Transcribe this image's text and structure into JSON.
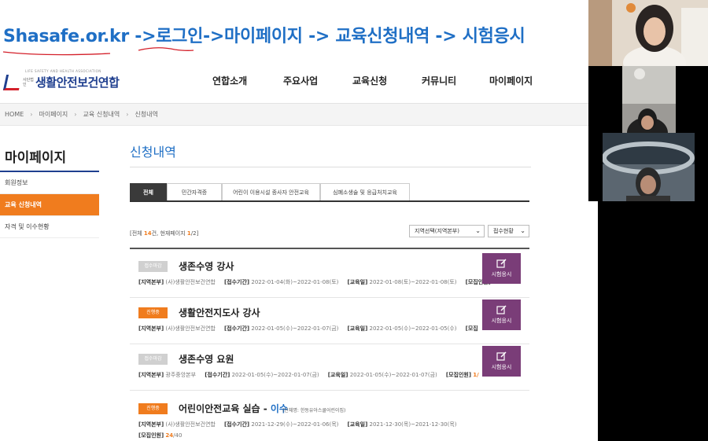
{
  "annotation": {
    "text": "Shasafe.or.kr ->로그인->마이페이지 -> 교육신청내역 -> 시험응시",
    "color": "#1f6fc5",
    "pen_color": "#d4202a"
  },
  "site": {
    "logo": {
      "tagline": "LIFE SAFETY AND HEALTH ASSOCIATION",
      "sub": "사단법인",
      "name": "생활안전보건연합"
    },
    "nav": [
      "연합소개",
      "주요사업",
      "교육신청",
      "커뮤니티",
      "마이페이지"
    ],
    "breadcrumb": [
      "HOME",
      "마이페이지",
      "교육 신청내역",
      "신청내역"
    ],
    "sidebar": {
      "title": "마이페이지",
      "items": [
        "회원정보",
        "교육 신청내역",
        "자격 및 이수현황"
      ],
      "active_index": 1
    },
    "content": {
      "title": "신청내역",
      "tabs": [
        "전체",
        "민간자격증",
        "어린이 이용시설 종사자 안전교육",
        "심폐소생술 및 응급처치교육"
      ],
      "active_tab": 0,
      "count": {
        "prefix": "[전체 ",
        "total": "14",
        "mid": "건, 현재페이지 ",
        "page": "1",
        "suffix": "/2]"
      },
      "filters": {
        "region": "지역선택(지역본부)",
        "status": "접수현황"
      },
      "items": [
        {
          "badge": "접수마감",
          "badge_type": "closed",
          "title": "생존수영 강사",
          "title_suffix": "",
          "note": "",
          "region_label": "[지역본부]",
          "region": "(사)생활안전보건연합",
          "period_label": "[접수기간]",
          "period": "2022-01-04(화)~2022-01-08(토)",
          "edu_label": "[교육일]",
          "edu": "2022-01-08(토)~2022-01-08(토)",
          "recruit_label": "[모집인원]",
          "recruit": "",
          "recruit_extra": "",
          "button": "시험응시"
        },
        {
          "badge": "진행중",
          "badge_type": "open",
          "title": "생활안전지도사 강사",
          "title_suffix": "",
          "note": "",
          "region_label": "[지역본부]",
          "region": "(사)생활안전보건연합",
          "period_label": "[접수기간]",
          "period": "2022-01-05(수)~2022-01-07(금)",
          "edu_label": "[교육일]",
          "edu": "2022-01-05(수)~2022-01-05(수)",
          "recruit_label": "[모집",
          "recruit": "",
          "recruit_extra": "",
          "button": "시험응시"
        },
        {
          "badge": "접수마감",
          "badge_type": "closed",
          "title": "생존수영 요원",
          "title_suffix": "",
          "note": "",
          "region_label": "[지역본부]",
          "region": "광주중앙본부",
          "period_label": "[접수기간]",
          "period": "2022-01-05(수)~2022-01-07(금)",
          "edu_label": "[교육일]",
          "edu": "2022-01-05(수)~2022-01-07(금)",
          "recruit_label": "[모집인원]",
          "recruit": "1/",
          "recruit_extra": "",
          "button": "시험응시"
        },
        {
          "badge": "진행중",
          "badge_type": "open",
          "title": "어린이안전교육 실습 - ",
          "title_suffix": "이수",
          "note": "(단체명: 한동유아스쿨어린이집)",
          "region_label": "[지역본부]",
          "region": "(사)생활안전보건연합",
          "period_label": "[접수기간]",
          "period": "2021-12-29(수)~2022-01-06(목)",
          "edu_label": "[교육일]",
          "edu": "2021-12-30(목)~2021-12-30(목)",
          "recruit_label": "[모집인원]",
          "recruit": "24",
          "recruit_extra": "/40",
          "button": ""
        }
      ]
    }
  },
  "colors": {
    "accent_blue": "#1f6fc5",
    "brand_navy": "#1f3f8f",
    "orange": "#f07c1e",
    "purple_button": "#7a3d78"
  }
}
